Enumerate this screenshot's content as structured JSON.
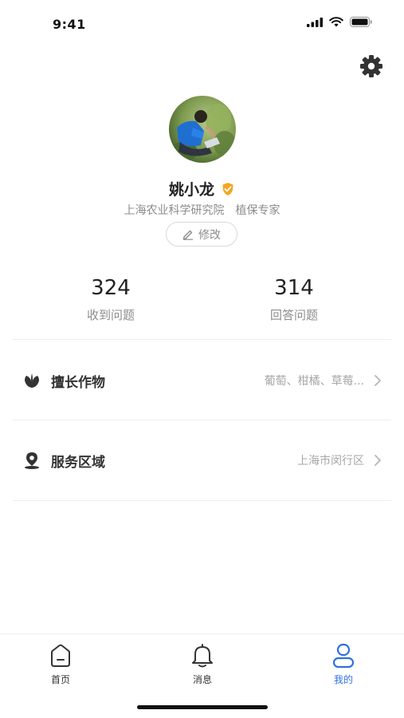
{
  "status_bar": {
    "time": "9:41"
  },
  "profile": {
    "name": "姚小龙",
    "organization": "上海农业科学研究院",
    "role": "植保专家",
    "edit_label": "修改"
  },
  "stats": [
    {
      "value": "324",
      "label": "收到问题"
    },
    {
      "value": "314",
      "label": "回答问题"
    }
  ],
  "rows": [
    {
      "label": "擅长作物",
      "value": "葡萄、柑橘、草莓...",
      "icon": "leaf-icon"
    },
    {
      "label": "服务区域",
      "value": "上海市闵行区",
      "icon": "location-pin-icon"
    }
  ],
  "tabs": [
    {
      "label": "首页",
      "icon": "home-icon",
      "active": false
    },
    {
      "label": "消息",
      "icon": "bell-icon",
      "active": false
    },
    {
      "label": "我的",
      "icon": "user-icon",
      "active": true
    }
  ],
  "colors": {
    "accent": "#2f6fe4",
    "verified_badge": "#f5a623"
  }
}
